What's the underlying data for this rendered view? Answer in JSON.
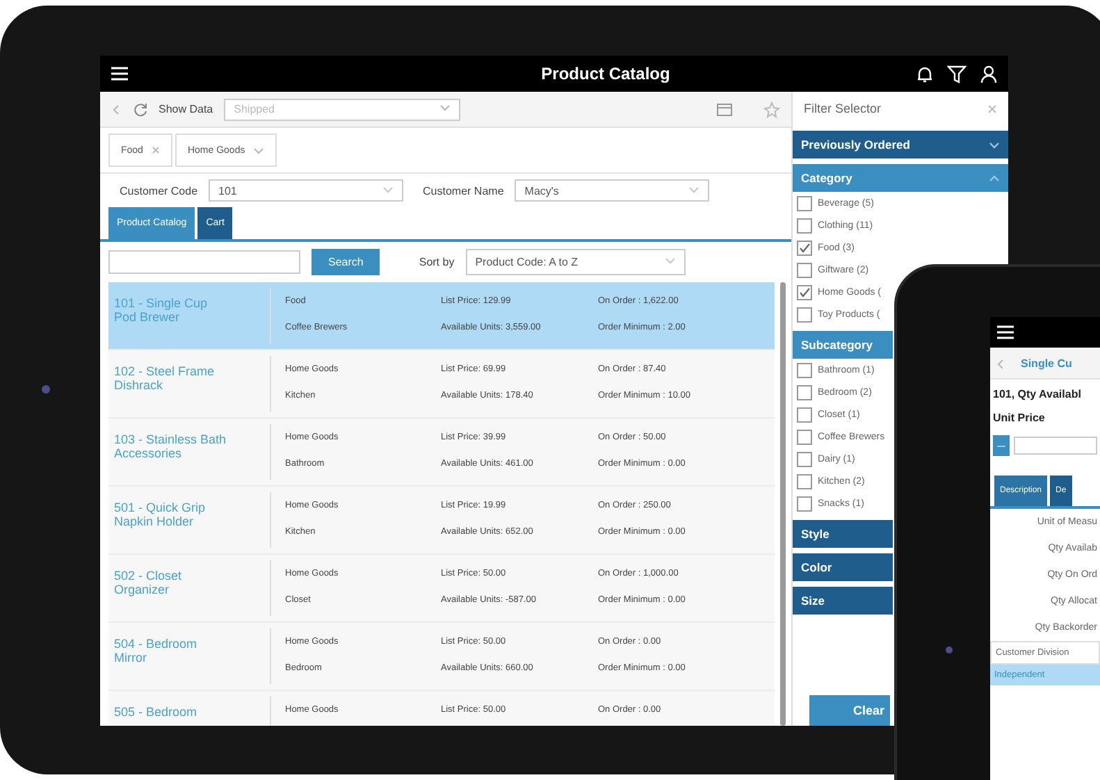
{
  "header": {
    "title": "Product Catalog"
  },
  "toolbar": {
    "show_data": "Show Data",
    "status_filter": {
      "placeholder": "Shipped"
    }
  },
  "chips": [
    {
      "label": "Food",
      "kind": "remove"
    },
    {
      "label": "Home Goods",
      "kind": "dropdown"
    }
  ],
  "customer": {
    "code_label": "Customer Code",
    "code": "101",
    "name_label": "Customer Name",
    "name": "Macy's"
  },
  "tabs": [
    {
      "label": "Product Catalog",
      "selected": true
    },
    {
      "label": "Cart",
      "selected": false
    }
  ],
  "search": {
    "button": "Search",
    "sort_label": "Sort by",
    "sort_value": "Product Code: A to Z"
  },
  "products": [
    {
      "name": "101 - Single Cup Pod Brewer",
      "category": "Food",
      "subcategory": "Coffee Brewers",
      "list_price": "List Price: 129.99",
      "available": "Available Units: 3,559.00",
      "on_order": "On Order : 1,622.00",
      "order_minimum": "Order Minimum : 2.00",
      "selected": true
    },
    {
      "name": "102 - Steel Frame Dishrack",
      "category": "Home Goods",
      "subcategory": "Kitchen",
      "list_price": "List Price: 69.99",
      "available": "Available Units: 178.40",
      "on_order": "On Order : 87.40",
      "order_minimum": "Order Minimum : 10.00",
      "selected": false
    },
    {
      "name": "103 - Stainless Bath Accessories",
      "category": "Home Goods",
      "subcategory": "Bathroom",
      "list_price": "List Price: 39.99",
      "available": "Available Units: 461.00",
      "on_order": "On Order : 50.00",
      "order_minimum": "Order Minimum : 0.00",
      "selected": false
    },
    {
      "name": "501 - Quick Grip Napkin Holder",
      "category": "Home Goods",
      "subcategory": "Kitchen",
      "list_price": "List Price: 19.99",
      "available": "Available Units: 652.00",
      "on_order": "On Order : 250.00",
      "order_minimum": "Order Minimum : 0.00",
      "selected": false
    },
    {
      "name": "502 - Closet Organizer",
      "category": "Home Goods",
      "subcategory": "Closet",
      "list_price": "List Price: 50.00",
      "available": "Available Units: -587.00",
      "on_order": "On Order : 1,000.00",
      "order_minimum": "Order Minimum : 0.00",
      "selected": false
    },
    {
      "name": "504 - Bedroom Mirror",
      "category": "Home Goods",
      "subcategory": "Bedroom",
      "list_price": "List Price: 50.00",
      "available": "Available Units: 660.00",
      "on_order": "On Order : 0.00",
      "order_minimum": "Order Minimum : 0.00",
      "selected": false
    },
    {
      "name": "505 - Bedroom",
      "category": "Home Goods",
      "list_price": "List Price: 50.00",
      "on_order": "On Order : 0.00",
      "selected": false
    }
  ],
  "filter": {
    "title": "Filter Selector",
    "sections": [
      {
        "title": "Previously Ordered",
        "expanded": false
      },
      {
        "title": "Category",
        "expanded": true,
        "items": [
          {
            "label": "Beverage (5)",
            "checked": false
          },
          {
            "label": "Clothing (11)",
            "checked": false
          },
          {
            "label": "Food (3)",
            "checked": true
          },
          {
            "label": "Giftware (2)",
            "checked": false
          },
          {
            "label": "Home Goods (",
            "checked": true
          },
          {
            "label": "Toy Products (",
            "checked": false
          }
        ]
      },
      {
        "title": "Subcategory",
        "expanded": true,
        "items": [
          {
            "label": "Bathroom (1)",
            "checked": false
          },
          {
            "label": "Bedroom (2)",
            "checked": false
          },
          {
            "label": "Closet (1)",
            "checked": false
          },
          {
            "label": "Coffee Brewers",
            "checked": false
          },
          {
            "label": "Dairy (1)",
            "checked": false
          },
          {
            "label": "Kitchen (2)",
            "checked": false
          },
          {
            "label": "Snacks (1)",
            "checked": false
          }
        ]
      },
      {
        "title": "Style",
        "expanded": false
      },
      {
        "title": "Color",
        "expanded": false
      },
      {
        "title": "Size",
        "expanded": false
      }
    ],
    "clear_button": "Clear"
  },
  "phone": {
    "back_title": "Single Cu",
    "qty_line": "101, Qty Availabl",
    "unit_price_label": "Unit Price",
    "tabs": [
      {
        "label": "Description",
        "selected": true
      },
      {
        "label": "De",
        "selected": false
      }
    ],
    "fields": [
      "Unit of Measu",
      "Qty Availab",
      "Qty On Ord",
      "Qty Allocat",
      "Qty Backorder"
    ],
    "division_label": "Customer Division",
    "division_options": [
      {
        "label": "Independent",
        "selected": true
      }
    ]
  }
}
